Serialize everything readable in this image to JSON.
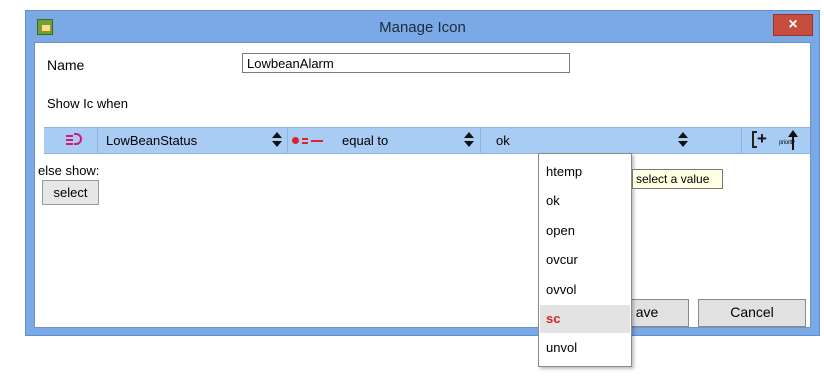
{
  "window": {
    "title": "Manage Icon",
    "close_label": "×",
    "colors": {
      "frame": "#7aa9e6",
      "close": "#c74d3f",
      "row": "#a9ccf4",
      "selected_text": "#e0202a"
    }
  },
  "form": {
    "name_label": "Name",
    "name_value": "LowbeanAlarm",
    "show_when_label": "Show Ic when"
  },
  "condition": {
    "signal_icon": "low-beam-lamp-icon",
    "signal": "LowBeanStatus",
    "operator_icon": "equal-operator-icon",
    "operator": "equal to",
    "value": "ok",
    "add_icon": "add-condition-icon",
    "priority_icon": "priority-icon",
    "priority_label": "priority"
  },
  "else": {
    "label": "else show:",
    "select_label": "select"
  },
  "buttons": {
    "save_label": "ave",
    "cancel_label": "Cancel"
  },
  "dropdown": {
    "options": [
      "htemp",
      "ok",
      "open",
      "ovcur",
      "ovvol",
      "sc",
      "unvol"
    ],
    "highlighted": "sc"
  },
  "tooltip": {
    "text": "select a value"
  }
}
